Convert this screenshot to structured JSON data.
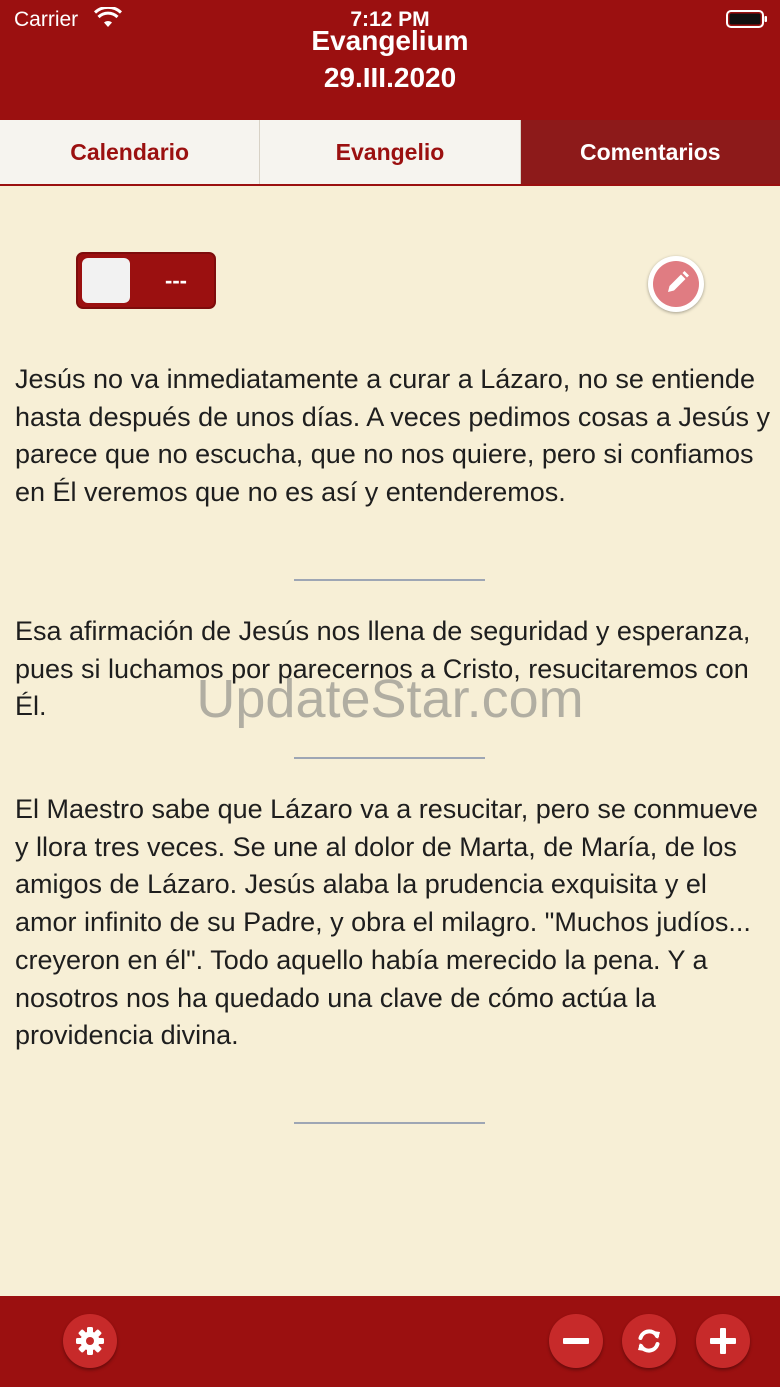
{
  "status_bar": {
    "carrier": "Carrier",
    "time": "7:12 PM"
  },
  "header": {
    "title": "Evangelium",
    "date": "29.III.2020"
  },
  "tabs": [
    {
      "label": "Calendario",
      "active": false
    },
    {
      "label": "Evangelio",
      "active": false
    },
    {
      "label": "Comentarios",
      "active": true
    }
  ],
  "toggle": {
    "label": "---",
    "on": false
  },
  "paragraphs": [
    "Jesús no va inmediatamente a curar a Lázaro, no se entiende hasta después de unos días. A veces pedimos cosas a Jesús y parece que no escucha, que no nos quiere, pero si confiamos en Él veremos que no es así y entenderemos.",
    "Esa afirmación de Jesús nos llena de seguridad y esperanza, pues si luchamos por parecernos a Cristo, resucitaremos con Él.",
    "El Maestro sabe que Lázaro va a resucitar, pero se conmueve y llora tres veces. Se une al dolor de Marta, de María, de los amigos de Lázaro. Jesús alaba la prudencia exquisita y el amor infinito de su Padre, y obra el milagro. \"Muchos judíos... creyeron en él\". Todo aquello había merecido la pena. Y a nosotros nos ha quedado una clave de cómo actúa la providencia divina."
  ],
  "watermark": "UpdateStar.com",
  "colors": {
    "brand": "#9b1010",
    "background": "#f7efd6",
    "active_tab": "#8d1a1a",
    "button": "#c72a2a"
  },
  "footer_icons": [
    "gear-icon",
    "minus-icon",
    "refresh-icon",
    "plus-icon"
  ]
}
